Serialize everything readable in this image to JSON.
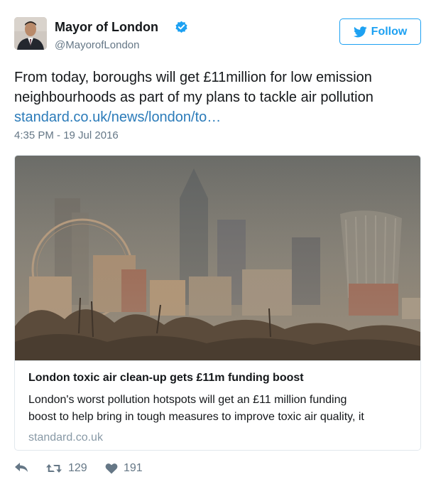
{
  "author": {
    "name": "Mayor of London",
    "handle": "@MayorofLondon",
    "verified_icon": "verified-badge-icon"
  },
  "follow_button": {
    "label": "Follow",
    "icon": "twitter-bird-icon",
    "color": "#1da1f2"
  },
  "tweet": {
    "text_line_1": "From today, boroughs will get £11million for low emission",
    "text_line_2": "neighbourhoods as part of my plans to tackle air pollution",
    "link_text": "standard.co.uk/news/london/to…",
    "timestamp": "4:35 PM - 19 Jul 2016"
  },
  "card": {
    "image_description_icon": "london-skyline-photo",
    "title": "London toxic air clean-up gets £11m funding boost",
    "description_line_1": "London's worst pollution hotspots will get an £11 million funding",
    "description_line_2": "boost to help bring in tough measures to improve toxic air quality, it",
    "domain": "standard.co.uk"
  },
  "actions": {
    "reply_icon": "reply-icon",
    "retweet_icon": "retweet-icon",
    "retweet_count": "129",
    "like_icon": "heart-icon",
    "like_count": "191"
  },
  "colors": {
    "link": "#2b7bb9",
    "secondary_text": "#657786",
    "accent": "#1da1f2"
  }
}
